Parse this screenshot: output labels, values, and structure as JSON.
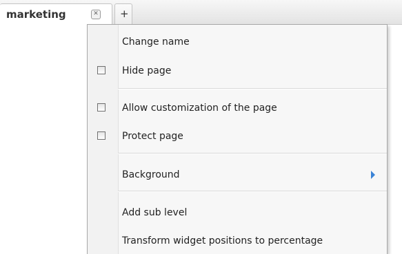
{
  "tabs": [
    {
      "label": "marketing",
      "close_symbol": "✕"
    },
    {
      "label": "+"
    }
  ],
  "menu": {
    "items": [
      {
        "label": "Change name"
      },
      {
        "label": "Hide page",
        "checked": false
      },
      {
        "label": "Allow customization of the page",
        "checked": false
      },
      {
        "label": "Protect page",
        "checked": false
      },
      {
        "label": "Background",
        "submenu": true
      },
      {
        "label": "Add sub level"
      },
      {
        "label": "Transform widget positions to percentage"
      }
    ]
  },
  "colors": {
    "submenu_arrow": "#3a83d6"
  }
}
